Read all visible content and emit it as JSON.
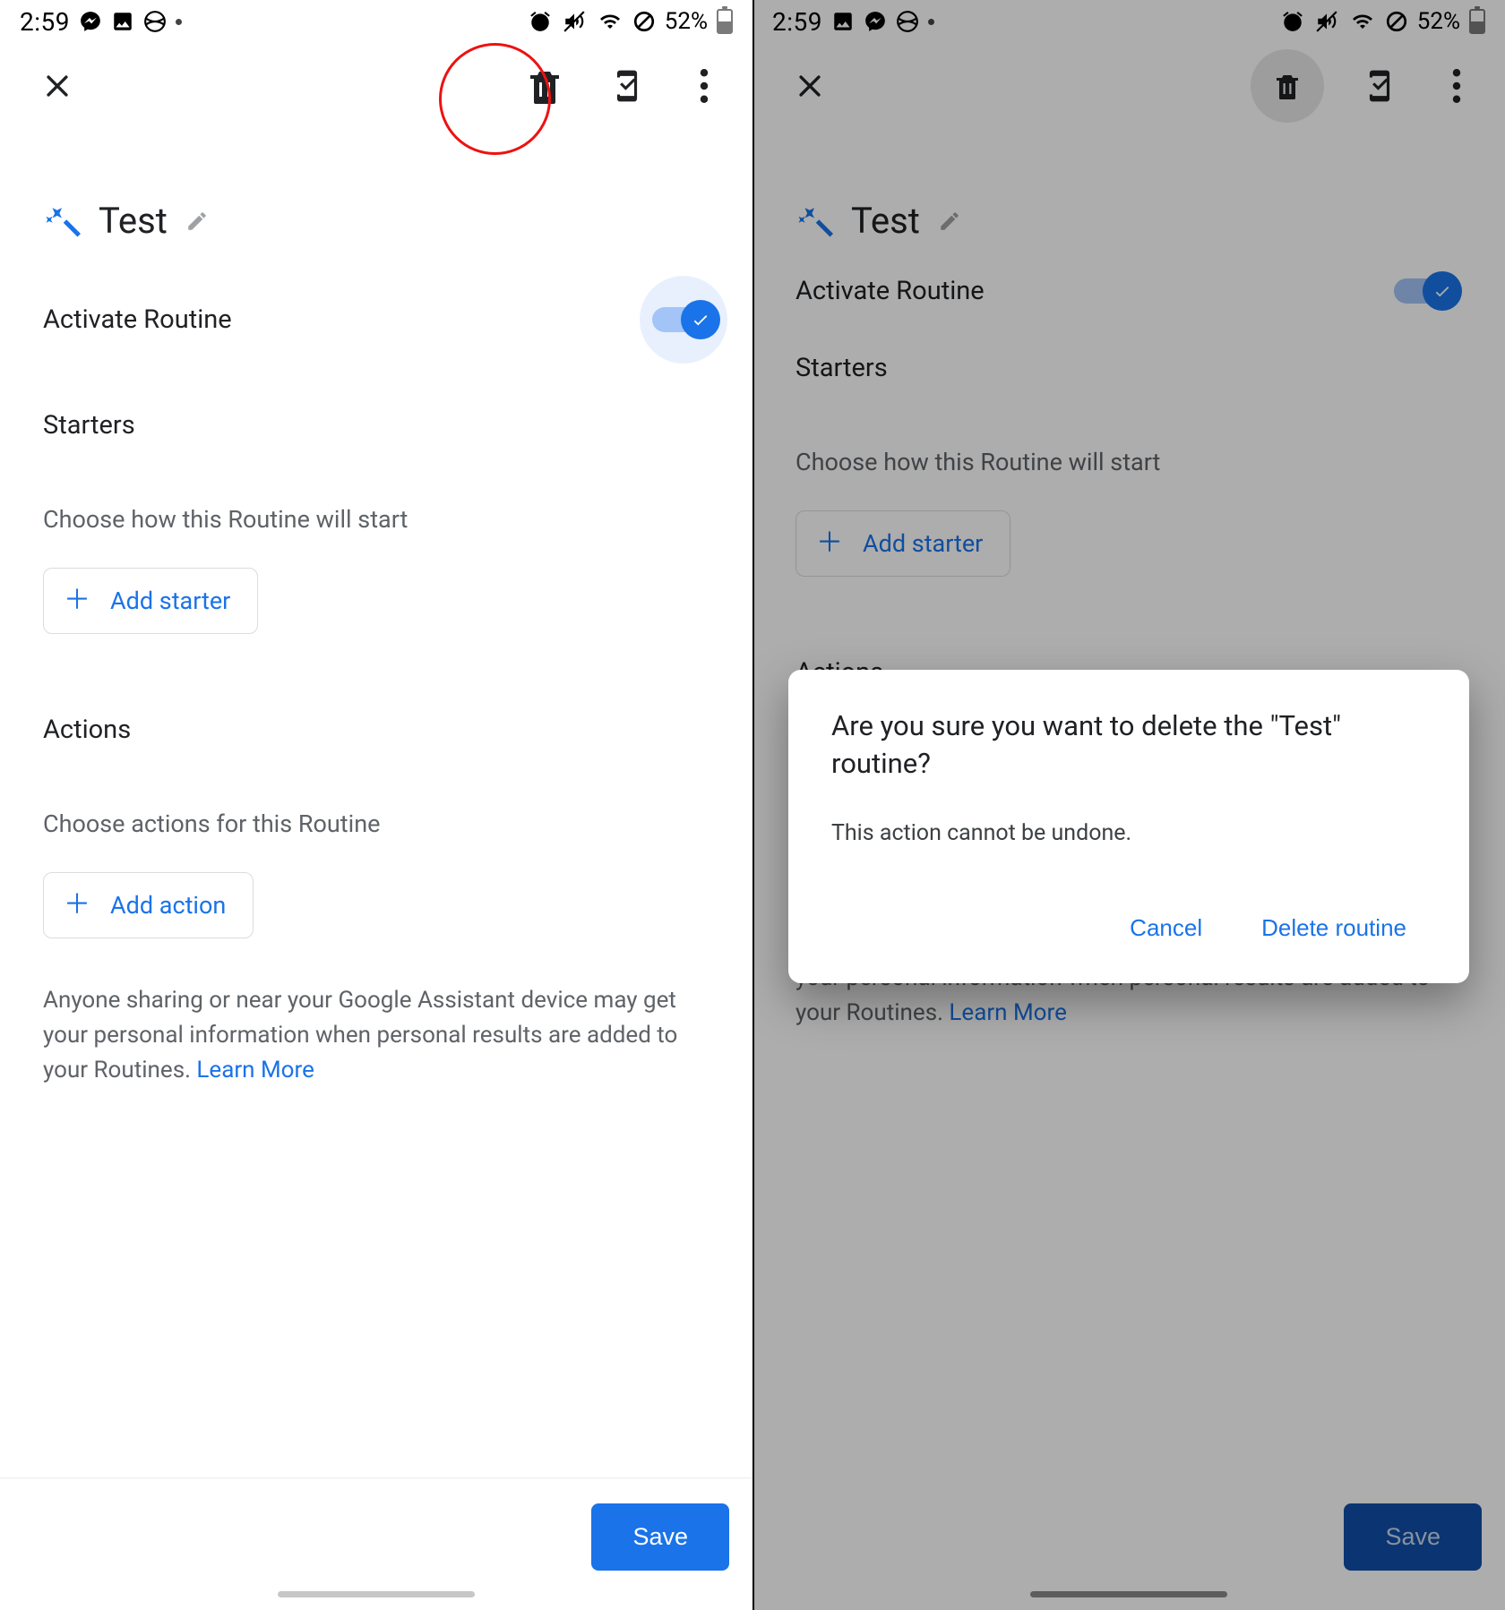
{
  "status": {
    "time": "2:59",
    "battery_pct": "52%"
  },
  "routine": {
    "name": "Test",
    "activate_label": "Activate Routine",
    "starters_head": "Starters",
    "starters_sub": "Choose how this Routine will start",
    "add_starter": "Add starter",
    "actions_head": "Actions",
    "actions_sub": "Choose actions for this Routine",
    "add_action": "Add action",
    "footnote_text": "Anyone sharing or near your Google Assistant device may get your personal information when personal results are added to your Routines. ",
    "learn_more": "Learn More"
  },
  "save_label": "Save",
  "dialog": {
    "title": "Are you sure you want to delete the \"Test\" routine?",
    "body": "This action cannot be undone.",
    "cancel": "Cancel",
    "confirm": "Delete routine"
  }
}
